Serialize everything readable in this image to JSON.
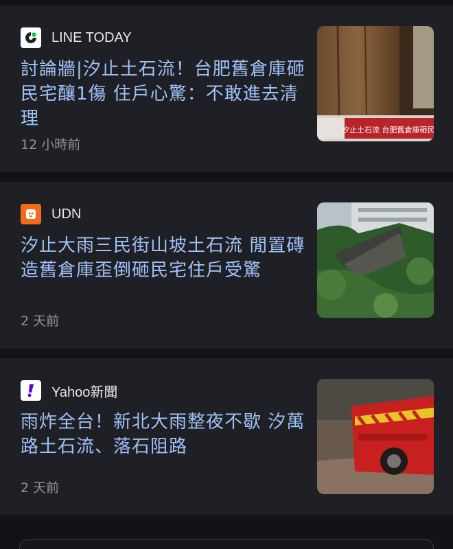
{
  "articles": [
    {
      "source": {
        "name": "LINE TODAY",
        "icon": "line-today-logo",
        "color": "#ffffff"
      },
      "headline": "討論牆|汐止土石流！台肥舊倉庫砸民宅釀1傷 住戶心驚：不敢進去清理",
      "time": "12 小時前",
      "thumbnail": {
        "caption": "汐止土石流 台肥舊倉庫砸民宅"
      }
    },
    {
      "source": {
        "name": "UDN",
        "icon": "udn-logo",
        "color": "#f26a1b"
      },
      "headline": "汐止大雨三民街山坡土石流 閒置磚造舊倉庫歪倒砸民宅住戶受驚",
      "time": "2 天前",
      "thumbnail": {}
    },
    {
      "source": {
        "name": "Yahoo新聞",
        "icon": "yahoo-news-logo",
        "color": "#6001d2"
      },
      "headline": "雨炸全台！新北大雨整夜不歇 汐萬路土石流、落石阻路",
      "time": "2 天前",
      "thumbnail": {}
    }
  ]
}
